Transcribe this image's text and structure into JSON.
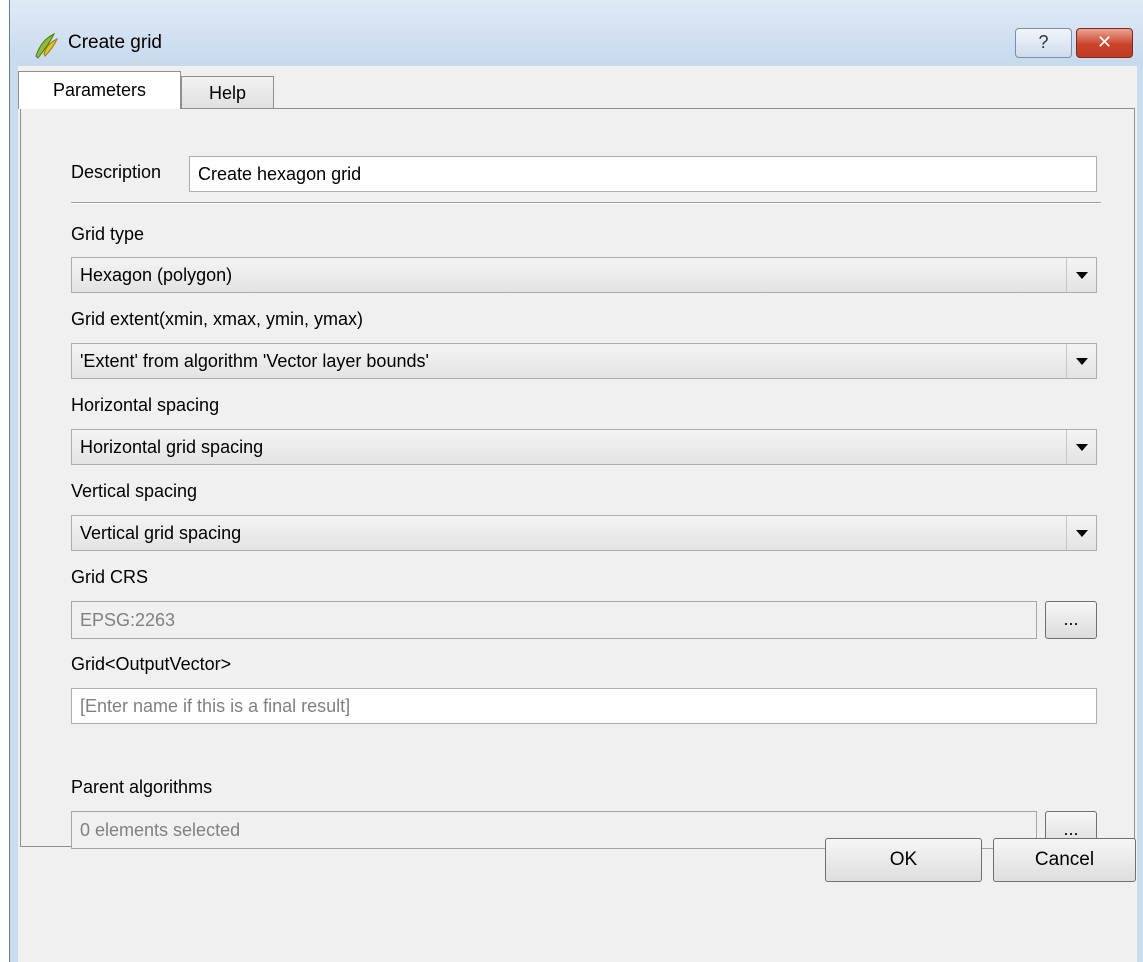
{
  "window": {
    "title": "Create grid",
    "help_icon": "question-icon",
    "close_icon": "close-icon",
    "help_glyph": "?",
    "close_glyph": "✕"
  },
  "tabs": [
    {
      "label": "Parameters"
    },
    {
      "label": "Help"
    }
  ],
  "form": {
    "description": {
      "label": "Description",
      "value": "Create hexagon grid"
    },
    "grid_type": {
      "label": "Grid type",
      "value": "Hexagon (polygon)"
    },
    "grid_extent": {
      "label": "Grid extent(xmin, xmax, ymin, ymax)",
      "value": "'Extent' from algorithm 'Vector layer bounds'"
    },
    "horizontal_spacing": {
      "label": "Horizontal spacing",
      "value": "Horizontal grid spacing"
    },
    "vertical_spacing": {
      "label": "Vertical spacing",
      "value": "Vertical grid spacing"
    },
    "grid_crs": {
      "label": "Grid CRS",
      "value": "EPSG:2263",
      "button": "..."
    },
    "grid_output": {
      "label": "Grid<OutputVector>",
      "placeholder": "[Enter name if this is a final result]"
    },
    "parent_algorithms": {
      "label": "Parent algorithms",
      "value": "0 elements selected",
      "button": "..."
    }
  },
  "buttons": {
    "ok": "OK",
    "cancel": "Cancel"
  }
}
